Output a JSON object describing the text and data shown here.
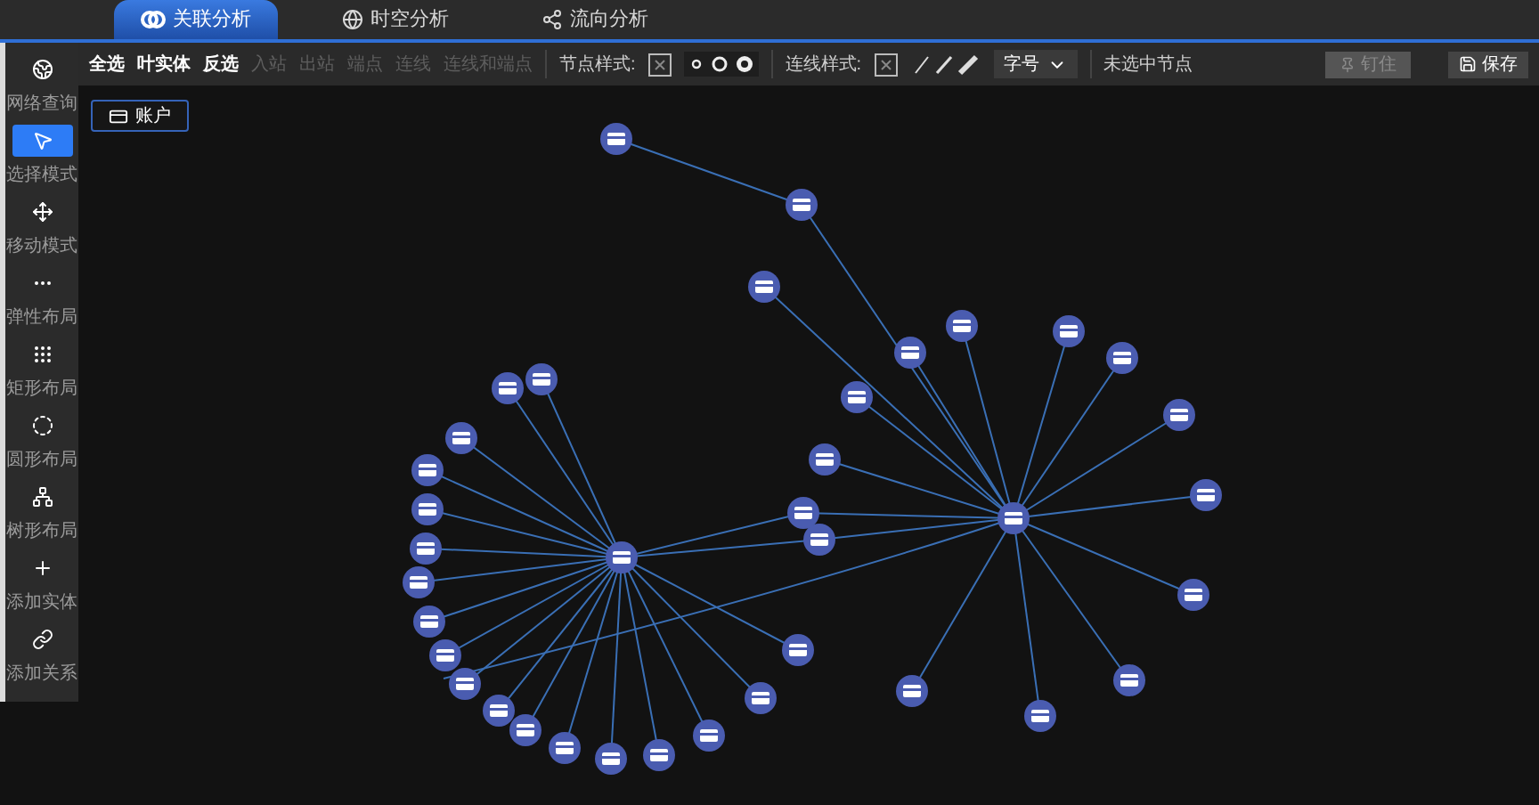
{
  "tabs": [
    {
      "label": "关联分析",
      "selected": true
    },
    {
      "label": "时空分析",
      "selected": false
    },
    {
      "label": "流向分析",
      "selected": false
    }
  ],
  "sidebar": {
    "items": [
      {
        "label": "网络查询",
        "selected": false
      },
      {
        "label": "选择模式",
        "selected": true
      },
      {
        "label": "移动模式",
        "selected": false
      },
      {
        "label": "弹性布局",
        "selected": false
      },
      {
        "label": "矩形布局",
        "selected": false
      },
      {
        "label": "圆形布局",
        "selected": false
      },
      {
        "label": "树形布局",
        "selected": false
      },
      {
        "label": "添加实体",
        "selected": false
      },
      {
        "label": "添加关系",
        "selected": false
      }
    ]
  },
  "toolbar": {
    "actions": [
      {
        "label": "全选",
        "disabled": false
      },
      {
        "label": "叶实体",
        "disabled": false
      },
      {
        "label": "反选",
        "disabled": false
      },
      {
        "label": "入站",
        "disabled": true
      },
      {
        "label": "出站",
        "disabled": true
      },
      {
        "label": "端点",
        "disabled": true
      },
      {
        "label": "连线",
        "disabled": true
      },
      {
        "label": "连线和端点",
        "disabled": true
      }
    ],
    "node_style_label": "节点样式:",
    "line_style_label": "连线样式:",
    "font_size": "字号",
    "status": "未选中节点",
    "pin_button": {
      "label": "钉住",
      "disabled": true
    },
    "save_button": {
      "label": "保存",
      "disabled": false
    }
  },
  "legend": {
    "label": "账户"
  }
}
